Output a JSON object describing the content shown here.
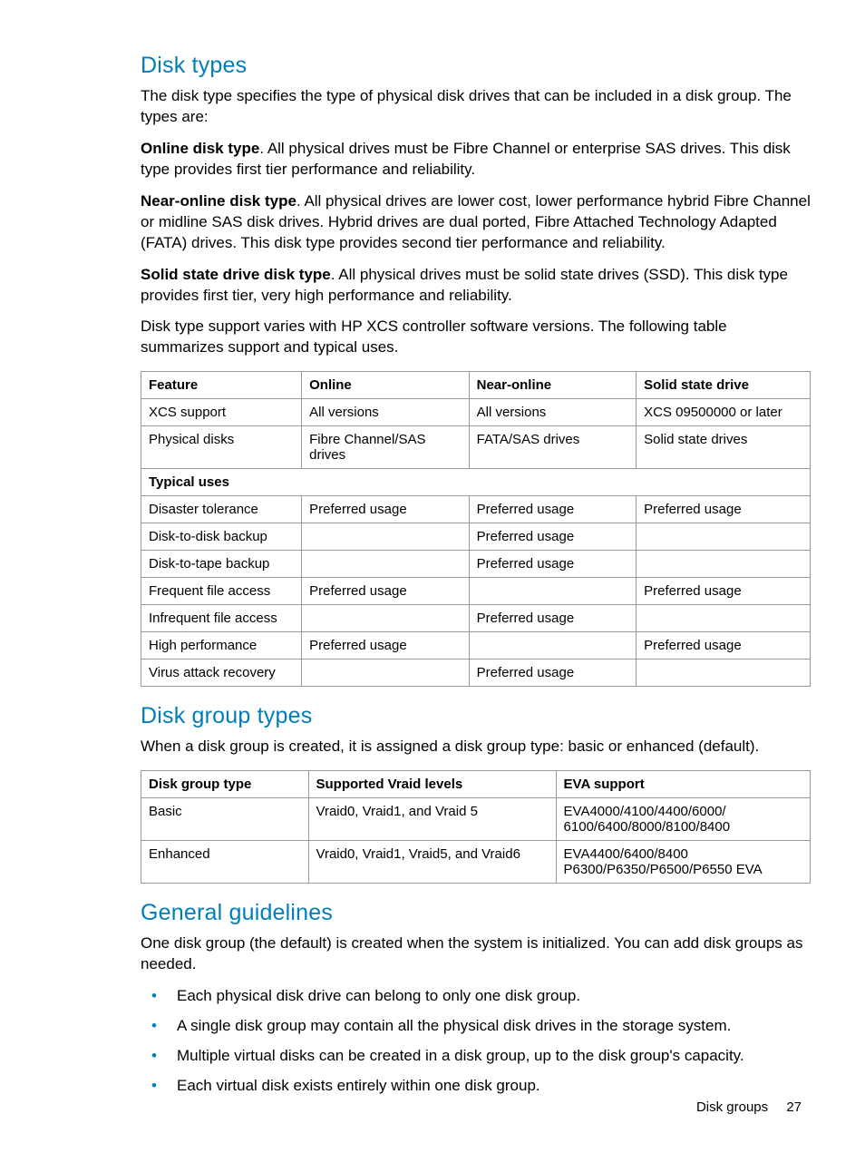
{
  "section1": {
    "heading": "Disk types",
    "p1": "The disk type specifies the type of physical disk drives that can be included in a disk group. The types are:",
    "p2_bold": "Online disk type",
    "p2_rest": ". All physical drives must be Fibre Channel or enterprise SAS drives. This disk type provides first tier performance and reliability.",
    "p3_bold": "Near-online disk type",
    "p3_rest": ". All physical drives are lower cost, lower performance hybrid Fibre Channel or midline SAS disk drives. Hybrid drives are dual ported, Fibre Attached Technology Adapted (FATA) drives. This disk type provides second tier performance and reliability.",
    "p4_bold": "Solid state drive disk type",
    "p4_rest": ". All physical drives must be solid state drives (SSD). This disk type provides first tier, very high performance and reliability.",
    "p5": "Disk type support varies with HP XCS controller software versions. The following table summarizes support and typical uses."
  },
  "table1": {
    "h1": "Feature",
    "h2": "Online",
    "h3": "Near-online",
    "h4": "Solid state drive",
    "r1c1": "XCS support",
    "r1c2": "All versions",
    "r1c3": "All versions",
    "r1c4": "XCS 09500000 or later",
    "r2c1": "Physical disks",
    "r2c2": "Fibre Channel/SAS drives",
    "r2c3": "FATA/SAS drives",
    "r2c4": "Solid state drives",
    "sub": "Typical uses",
    "r3c1": "Disaster tolerance",
    "r3c2": "Preferred usage",
    "r3c3": "Preferred usage",
    "r3c4": "Preferred usage",
    "r4c1": "Disk-to-disk backup",
    "r4c2": "",
    "r4c3": "Preferred usage",
    "r4c4": "",
    "r5c1": "Disk-to-tape backup",
    "r5c2": "",
    "r5c3": "Preferred usage",
    "r5c4": "",
    "r6c1": "Frequent file access",
    "r6c2": "Preferred usage",
    "r6c3": "",
    "r6c4": "Preferred usage",
    "r7c1": "Infrequent file access",
    "r7c2": "",
    "r7c3": "Preferred usage",
    "r7c4": "",
    "r8c1": "High performance",
    "r8c2": "Preferred usage",
    "r8c3": "",
    "r8c4": "Preferred usage",
    "r9c1": "Virus attack recovery",
    "r9c2": "",
    "r9c3": "Preferred usage",
    "r9c4": ""
  },
  "section2": {
    "heading": "Disk group types",
    "p1": "When a disk group is created, it is assigned a disk group type: basic or enhanced (default)."
  },
  "table2": {
    "h1": "Disk group type",
    "h2": "Supported Vraid levels",
    "h3": "EVA support",
    "r1c1": "Basic",
    "r1c2": "Vraid0, Vraid1, and Vraid 5",
    "r1c3": "EVA4000/4100/4400/6000/ 6100/6400/8000/8100/8400",
    "r2c1": "Enhanced",
    "r2c2": "Vraid0, Vraid1, Vraid5, and Vraid6",
    "r2c3": "EVA4400/6400/8400 P6300/P6350/P6500/P6550 EVA"
  },
  "section3": {
    "heading": "General guidelines",
    "p1": "One disk group (the default) is created when the system is initialized. You can add disk groups as needed.",
    "b1": "Each physical disk drive can belong to only one disk group.",
    "b2": "A single disk group may contain all the physical disk drives in the storage system.",
    "b3": "Multiple virtual disks can be created in a disk group, up to the disk group's capacity.",
    "b4": "Each virtual disk exists entirely within one disk group."
  },
  "footer": {
    "label": "Disk groups",
    "page": "27"
  }
}
